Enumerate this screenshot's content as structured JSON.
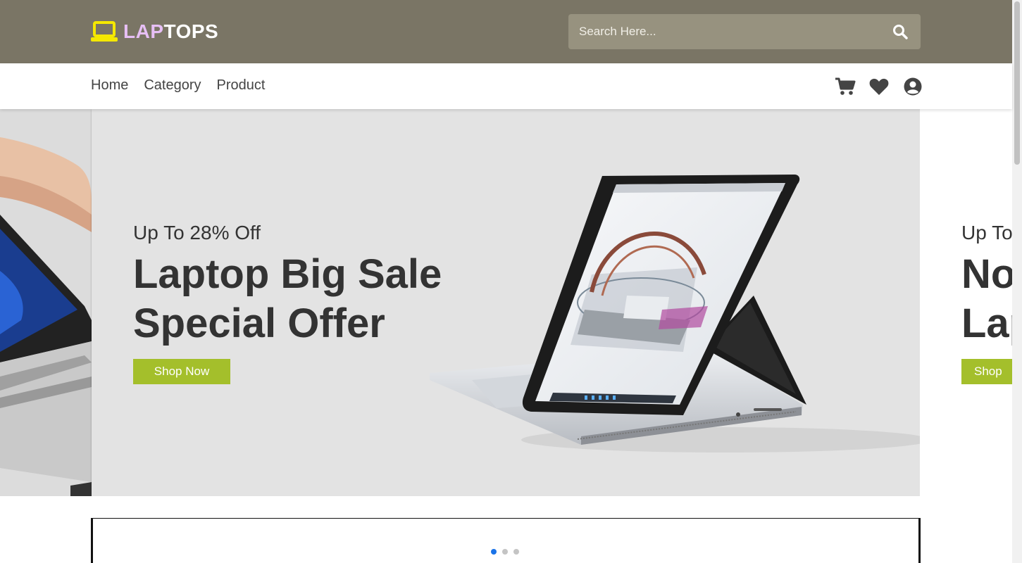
{
  "header": {
    "logo_part1": "LAP",
    "logo_part2": "TOPS",
    "logo_icon": "laptop-icon",
    "search_placeholder": "Search Here...",
    "search_icon": "search-icon"
  },
  "nav": {
    "links": [
      "Home",
      "Category",
      "Product"
    ],
    "icons": [
      "cart-icon",
      "heart-icon",
      "user-icon"
    ]
  },
  "carousel": {
    "active_slide": {
      "subtitle": "Up To 28% Off",
      "title_line1": "Laptop Big Sale",
      "title_line2": "Special Offer",
      "button": "Shop Now"
    },
    "next_slide_partial": {
      "subtitle": "Up To",
      "title_line1": "No",
      "title_line2": "Lap",
      "button": "Shop"
    },
    "dots_total": 3,
    "dots_active_index": 0
  },
  "colors": {
    "header_bg": "#7a7565",
    "search_bg": "#97927f",
    "logo_icon": "#f5e800",
    "logo_lap": "#e7bff5",
    "button_green": "#a4bf2b",
    "slide_bg": "#e3e3e3",
    "dot_active": "#1a73e8"
  }
}
